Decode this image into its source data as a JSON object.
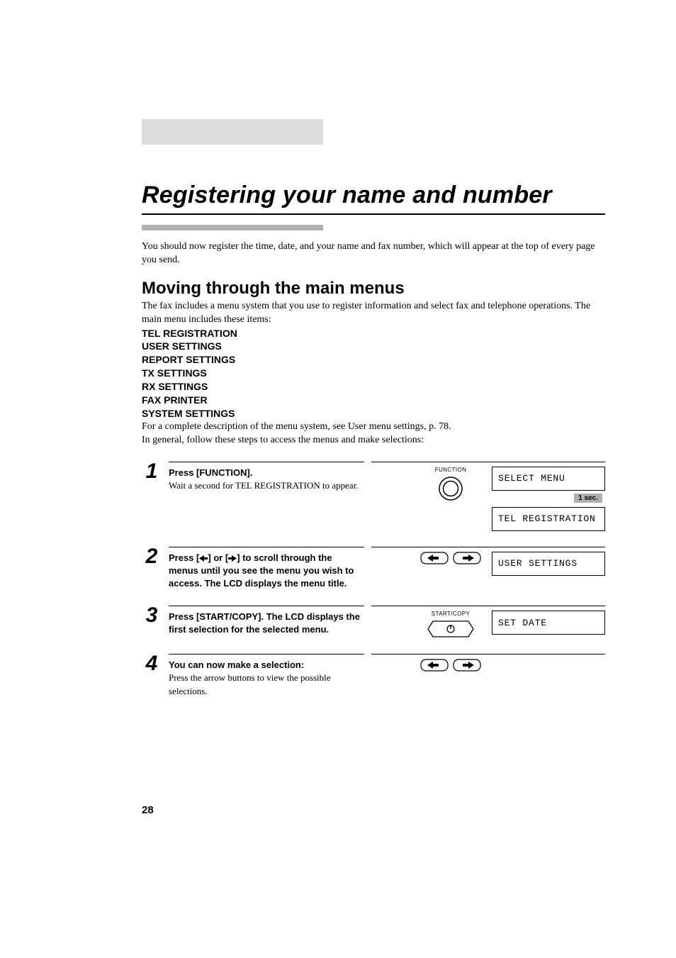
{
  "title": "Registering your name and number",
  "intro": "You should now register the time, date, and your name and fax number, which will appear at the top of every page you send.",
  "section": {
    "heading": "Moving through the main menus",
    "desc": "The fax includes a menu system that you use to register information and select fax and telephone operations. The main menu includes these items:",
    "menu_items": [
      "TEL REGISTRATION",
      "USER SETTINGS",
      "REPORT SETTINGS",
      "TX SETTINGS",
      "RX SETTINGS",
      "FAX PRINTER",
      "SYSTEM SETTINGS"
    ],
    "after1": "For a complete description of the menu system, see User menu settings, p. 78.",
    "after2": "In general, follow these steps to access the menus and make selections:"
  },
  "steps": [
    {
      "num": "1",
      "bold": "Press [FUNCTION].",
      "plain": "Wait a second for TEL REGISTRATION to appear.",
      "button_label": "FUNCTION",
      "lcd1": "SELECT MENU",
      "delay": "1 sec.",
      "lcd2": "TEL REGISTRATION"
    },
    {
      "num": "2",
      "bolda": "Press [",
      "boldb": "] or [",
      "boldc": "] to scroll through the menus until you see the menu you wish to access. The LCD displays the menu title.",
      "lcd1": "USER SETTINGS"
    },
    {
      "num": "3",
      "bold": "Press [START/COPY]. The LCD displays the first selection for the selected menu.",
      "button_label": "START/COPY",
      "lcd1": "SET DATE"
    },
    {
      "num": "4",
      "bold": "You can now make a selection:",
      "plain": "Press the arrow buttons to view the possible selections."
    }
  ],
  "icons": {
    "left_arrow": "left-arrow-icon",
    "right_arrow": "right-arrow-icon",
    "function_button": "function-button-icon",
    "start_copy_button": "start-copy-button-icon"
  },
  "page_number": "28"
}
